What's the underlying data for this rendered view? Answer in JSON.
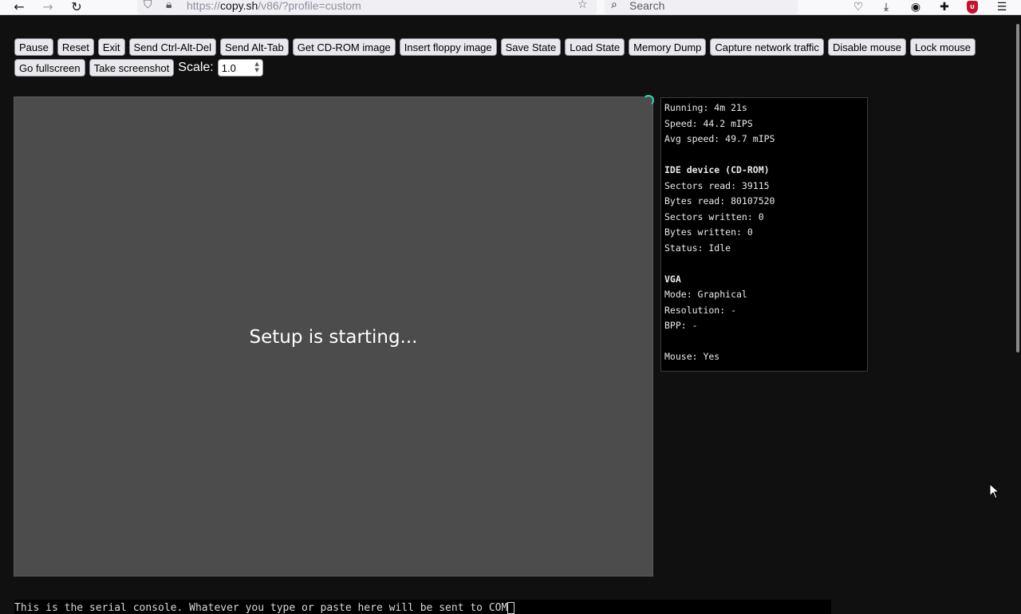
{
  "browser": {
    "url_scheme": "https://",
    "url_host": "copy.sh",
    "url_path": "/v86/?profile=custom",
    "search_placeholder": "Search",
    "ublock_label": "U",
    "icons": [
      "back-arrow-icon",
      "forward-arrow-icon",
      "reload-icon",
      "shield-icon",
      "lock-icon",
      "star-icon",
      "search-icon",
      "pocket-icon",
      "download-icon",
      "account-icon",
      "extensions-icon",
      "ublock-icon",
      "menu-icon"
    ]
  },
  "controls": {
    "buttons": [
      "Pause",
      "Reset",
      "Exit",
      "Send Ctrl-Alt-Del",
      "Send Alt-Tab",
      "Get CD-ROM image",
      "Insert floppy image",
      "Save State",
      "Load State",
      "Memory Dump",
      "Capture network traffic",
      "Disable mouse",
      "Lock mouse",
      "Go fullscreen",
      "Take screenshot"
    ],
    "scale_label": "Scale:",
    "scale_value": "1.0"
  },
  "screen": {
    "message": "Setup is starting..."
  },
  "info": {
    "running": "Running: 4m 21s",
    "speed": "Speed: 44.2 mIPS",
    "avg_speed": "Avg speed: 49.7 mIPS",
    "ide_heading": "IDE device (CD-ROM)",
    "sectors_read": "Sectors read: 39115",
    "bytes_read": "Bytes read: 80107520",
    "sectors_written": "Sectors written: 0",
    "bytes_written": "Bytes written: 0",
    "status": "Status: Idle",
    "vga_heading": "VGA",
    "mode": "Mode: Graphical",
    "resolution": "Resolution: -",
    "bpp": "BPP: -",
    "mouse": "Mouse: Yes"
  },
  "serial": {
    "text": "This is the serial console. Whatever you type or paste here will be sent to COM"
  }
}
